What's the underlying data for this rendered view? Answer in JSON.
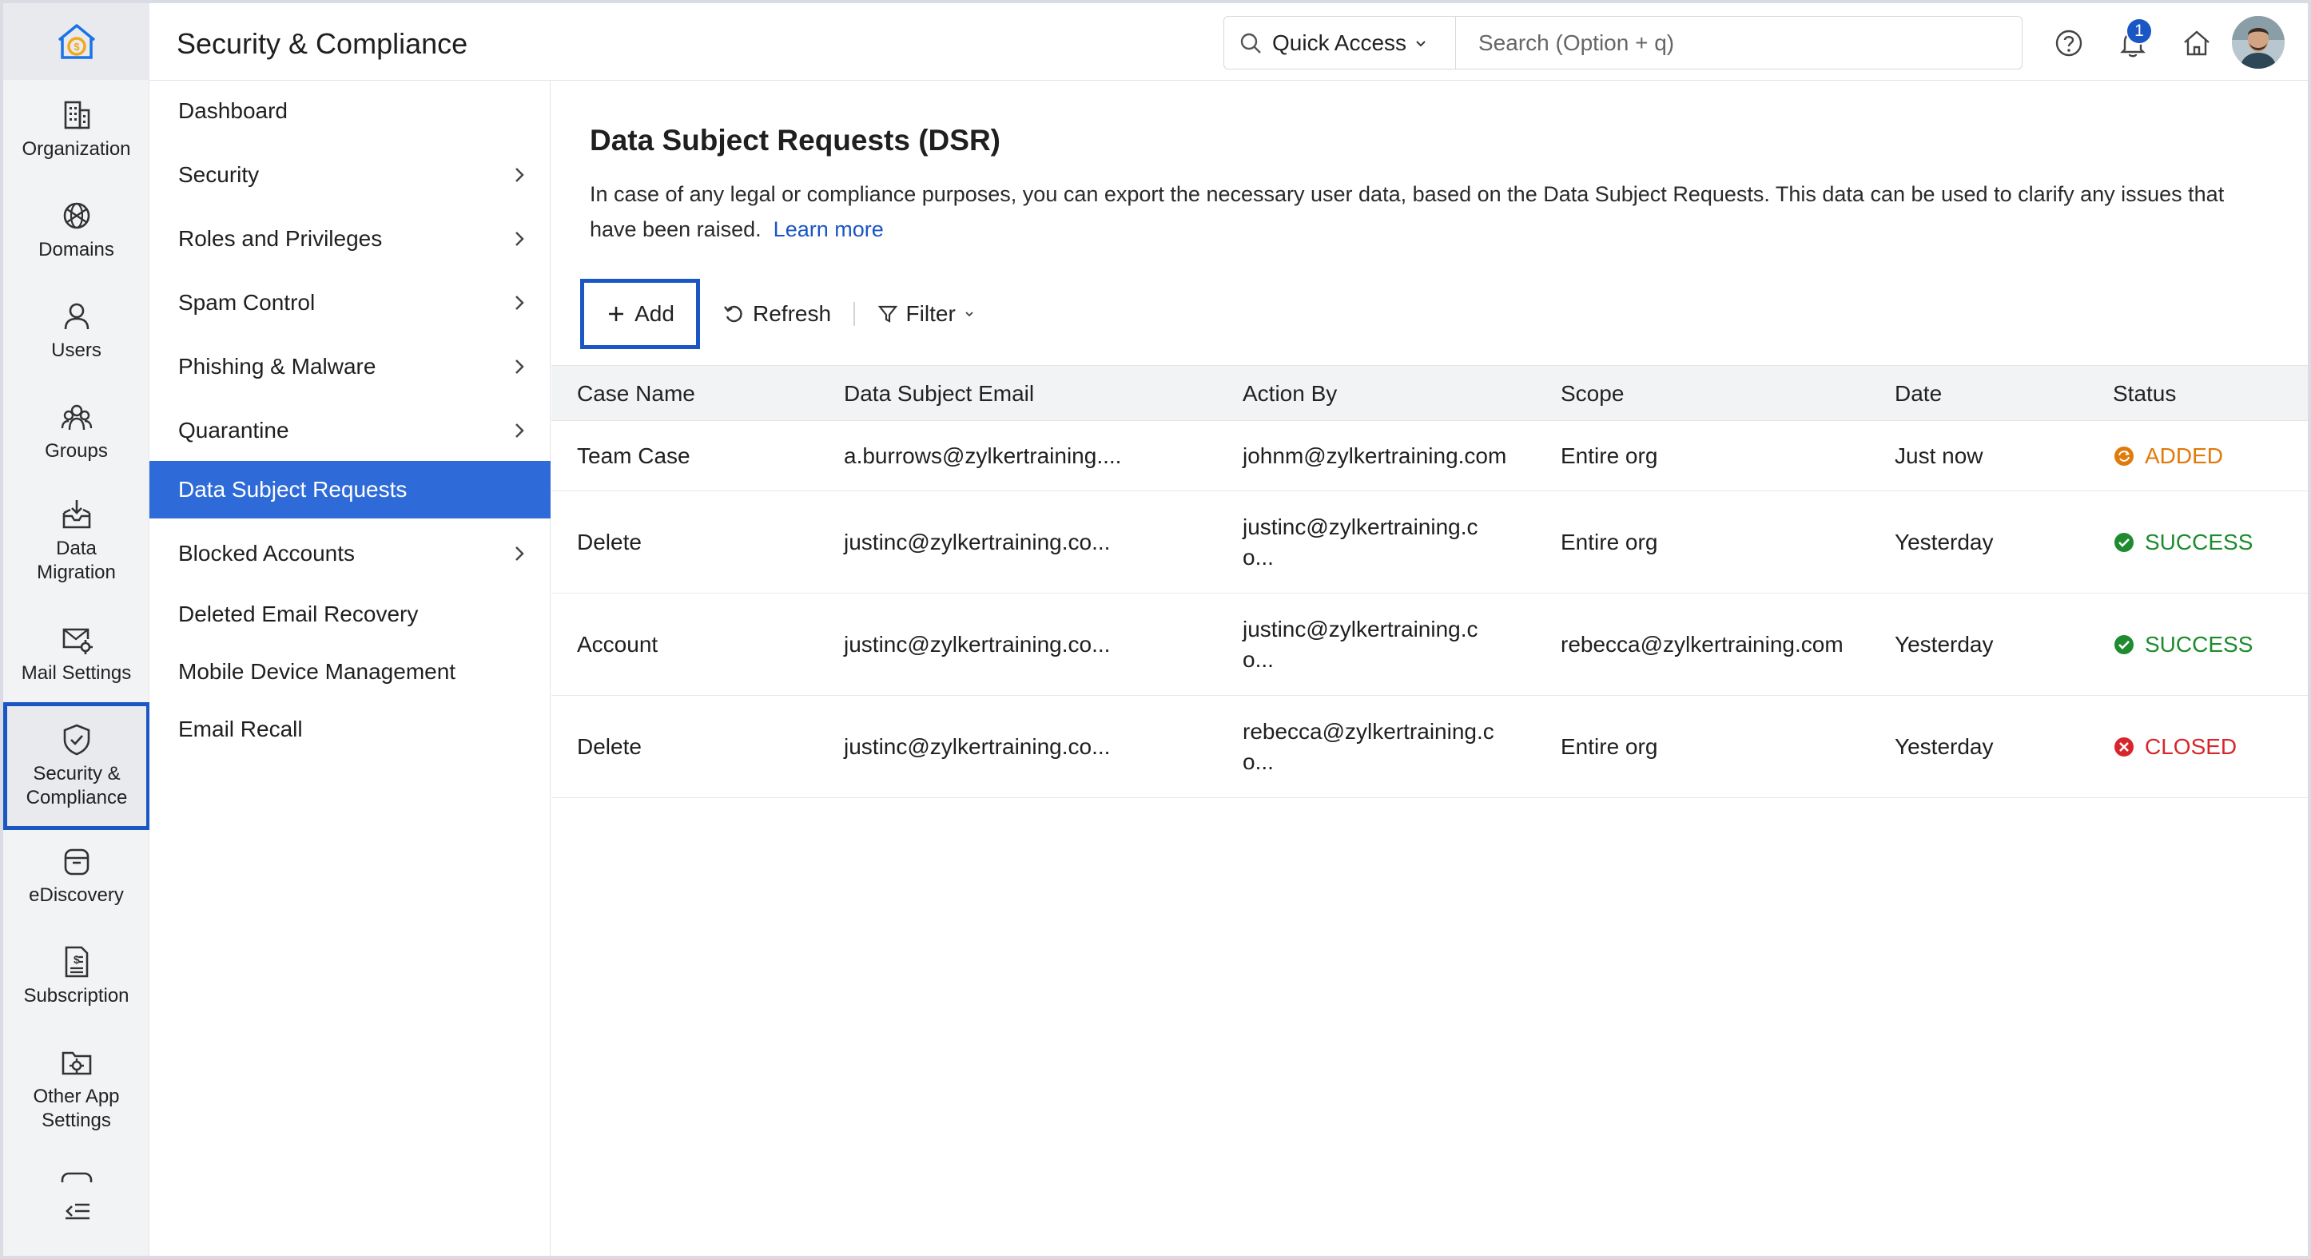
{
  "header": {
    "title": "Security & Compliance",
    "quick_access_label": "Quick Access",
    "search_placeholder": "Search (Option + q)",
    "notification_count": "1"
  },
  "rail": {
    "items": [
      {
        "label": "Organization",
        "icon": "building-icon"
      },
      {
        "label": "Domains",
        "icon": "globe-icon"
      },
      {
        "label": "Users",
        "icon": "user-icon"
      },
      {
        "label": "Groups",
        "icon": "group-icon"
      },
      {
        "label": "Data Migration",
        "icon": "inbox-download-icon"
      },
      {
        "label": "Mail Settings",
        "icon": "mail-gear-icon"
      },
      {
        "label": "Security & Compliance",
        "icon": "shield-check-icon",
        "active": true
      },
      {
        "label": "eDiscovery",
        "icon": "archive-box-icon"
      },
      {
        "label": "Subscription",
        "icon": "invoice-icon"
      },
      {
        "label": "Other App Settings",
        "icon": "folder-gear-icon"
      }
    ]
  },
  "subnav": {
    "items": [
      {
        "label": "Dashboard",
        "has_children": false
      },
      {
        "label": "Security",
        "has_children": true
      },
      {
        "label": "Roles and Privileges",
        "has_children": true
      },
      {
        "label": "Spam Control",
        "has_children": true
      },
      {
        "label": "Phishing & Malware",
        "has_children": true
      },
      {
        "label": "Quarantine",
        "has_children": true
      },
      {
        "label": "Data Subject Requests",
        "has_children": false,
        "active": true
      },
      {
        "label": "Blocked Accounts",
        "has_children": true
      },
      {
        "label": "Deleted Email Recovery",
        "has_children": false
      },
      {
        "label": "Mobile Device Management",
        "has_children": false
      },
      {
        "label": "Email Recall",
        "has_children": false
      }
    ]
  },
  "main": {
    "title": "Data Subject Requests (DSR)",
    "description": "In case of any legal or compliance purposes, you can export the necessary user data, based on the Data Subject Requests. This data can be used to clarify any issues that have been raised.",
    "learn_more": "Learn more",
    "toolbar": {
      "add_label": "Add",
      "refresh_label": "Refresh",
      "filter_label": "Filter"
    },
    "table": {
      "columns": [
        "Case Name",
        "Data Subject Email",
        "Action By",
        "Scope",
        "Date",
        "Status"
      ],
      "rows": [
        {
          "case_name": "Team Case",
          "email": "a.burrows@zylkertraining....",
          "action_by": "johnm@zylkertraining.com",
          "scope": "Entire org",
          "date": "Just now",
          "status": "ADDED"
        },
        {
          "case_name": "Delete",
          "email": "justinc@zylkertraining.co...",
          "action_by": "justinc@zylkertraining.co...",
          "scope": "Entire org",
          "date": "Yesterday",
          "status": "SUCCESS"
        },
        {
          "case_name": "Account",
          "email": "justinc@zylkertraining.co...",
          "action_by": "justinc@zylkertraining.co...",
          "scope": "rebecca@zylkertraining.com",
          "date": "Yesterday",
          "status": "SUCCESS"
        },
        {
          "case_name": "Delete",
          "email": "justinc@zylkertraining.co...",
          "action_by": "rebecca@zylkertraining.co...",
          "scope": "Entire org",
          "date": "Yesterday",
          "status": "CLOSED"
        }
      ]
    }
  },
  "colors": {
    "accent": "#1a56c4",
    "active_nav": "#2f6bd8",
    "added": "#e07a0a",
    "success": "#1e8b2f",
    "closed": "#d7262b"
  }
}
